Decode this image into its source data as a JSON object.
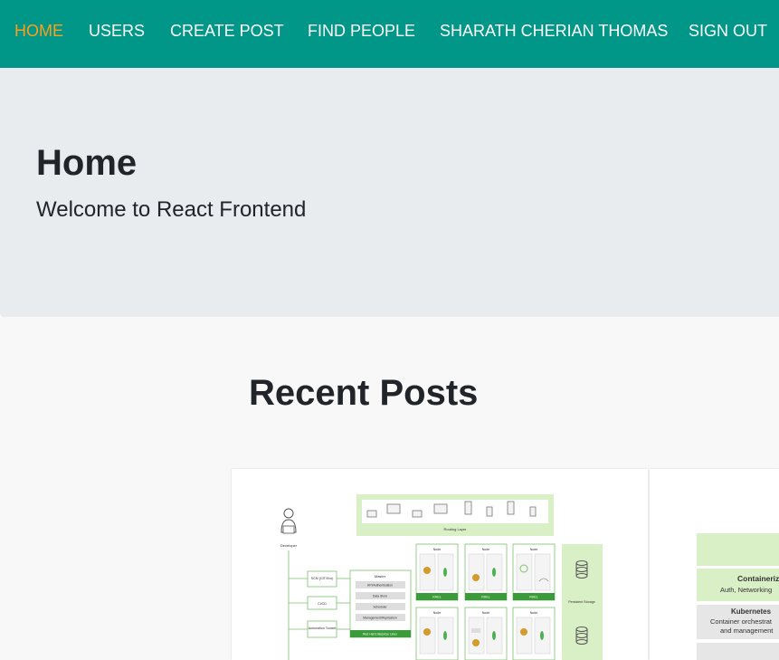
{
  "nav": {
    "items": [
      {
        "label": "HOME",
        "active": true
      },
      {
        "label": "USERS",
        "active": false
      },
      {
        "label": "CREATE POST",
        "active": false
      },
      {
        "label": "FIND PEOPLE",
        "active": false
      },
      {
        "label": "SHARATH CHERIAN THOMAS",
        "active": false
      },
      {
        "label": "SIGN OUT",
        "active": false
      }
    ]
  },
  "hero": {
    "title": "Home",
    "lead": "Welcome to React Frontend"
  },
  "posts": {
    "heading": "Recent Posts"
  },
  "card1": {
    "routing": "Routing Layer",
    "developer": "Developer",
    "scm": "SCM (GIT/Svn)",
    "cicd": "CI/CD",
    "automation": "Automation Toolset",
    "master": "Master",
    "master_items": [
      "API/Authentication",
      "Data Store",
      "Scheduler",
      "Management/Replication"
    ],
    "rhel_bar": "Red Hat Enterprise Linux",
    "node": "Node",
    "pod": "Pod",
    "rhel": "RHEL",
    "storage": "Persistent Storage"
  },
  "card2": {
    "container_title": "Containeriz",
    "container_sub": "Auth, Networking",
    "kube_title": "Kubernetes",
    "kube_sub1": "Container orchestrat",
    "kube_sub2": "and management"
  },
  "colors": {
    "navbar": "#009688",
    "nav_active": "#ff9f1c",
    "jumbotron": "#e9ecef",
    "diagram_green": "#3b9b3b",
    "diagram_light_green": "#d9efc6"
  }
}
